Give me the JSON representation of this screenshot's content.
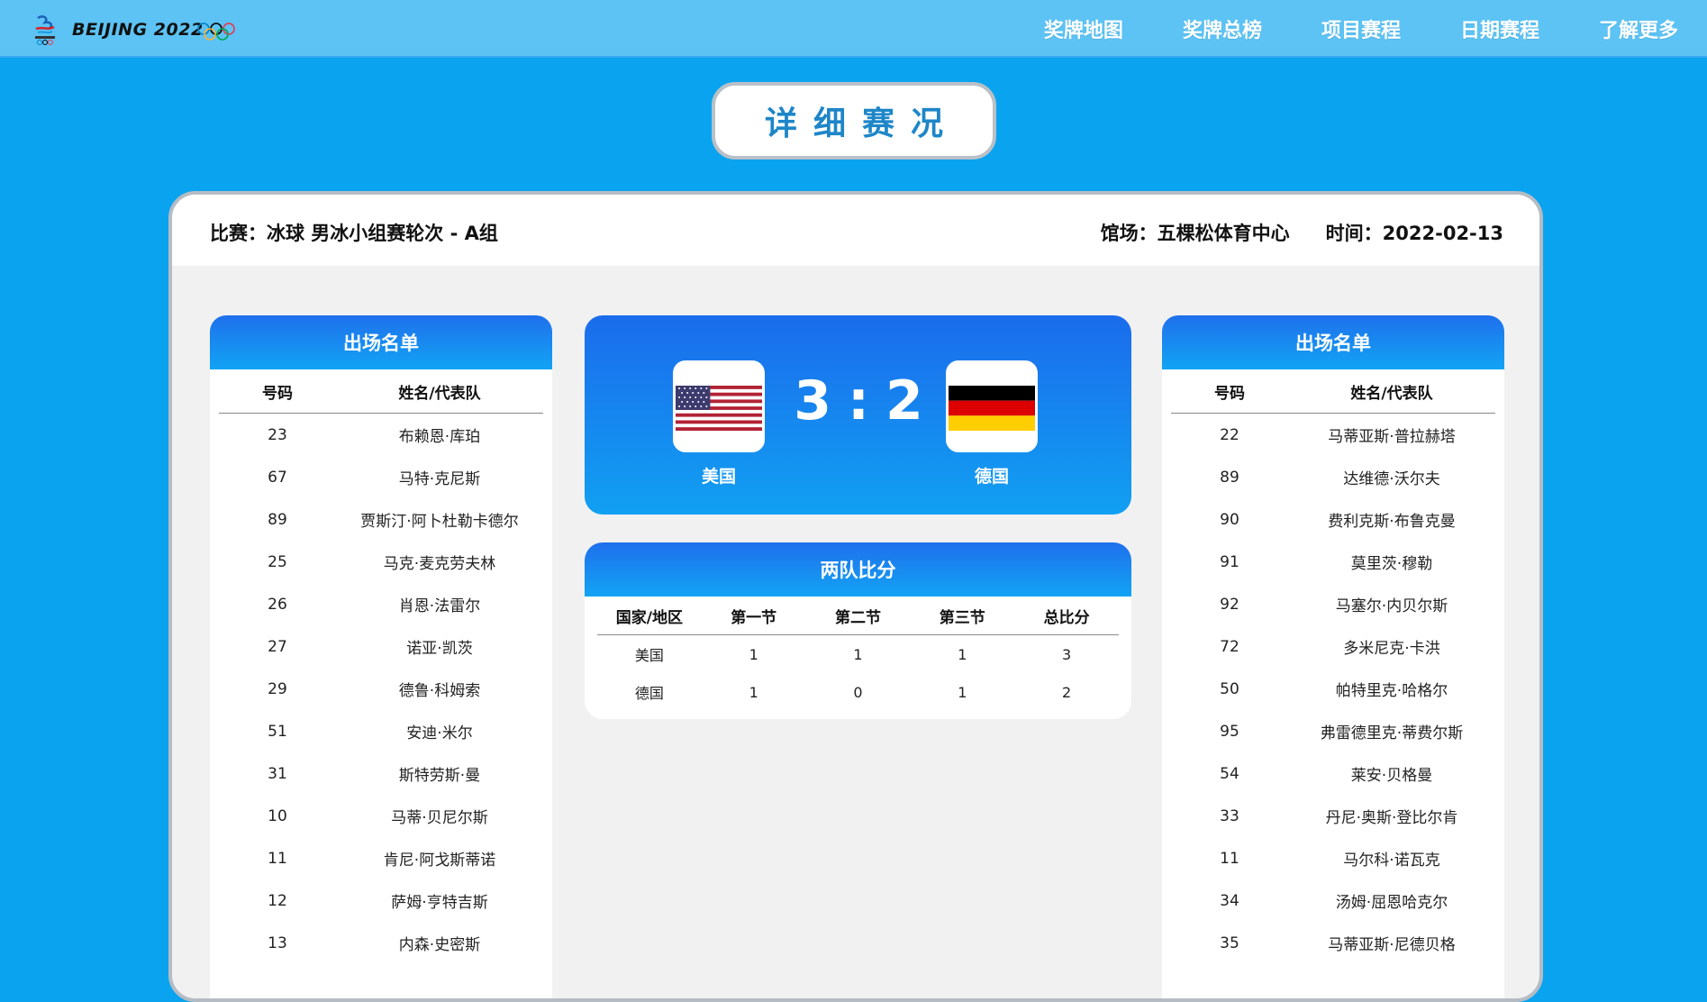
{
  "header": {
    "logo_text": "BEIJING 2022",
    "nav": [
      "奖牌地图",
      "奖牌总榜",
      "项目赛程",
      "日期赛程",
      "了解更多"
    ]
  },
  "page_title": "详细赛况",
  "match": {
    "info": "比赛：冰球 男冰小组赛轮次 - A组",
    "venue": "馆场：五棵松体育中心",
    "time": "时间：2022-02-13"
  },
  "score": {
    "home_team": "美国",
    "away_team": "德国",
    "home_score": "3",
    "away_score": "2",
    "separator": ":"
  },
  "periods": {
    "title": "两队比分",
    "headers": [
      "国家/地区",
      "第一节",
      "第二节",
      "第三节",
      "总比分"
    ],
    "rows": [
      [
        "美国",
        "1",
        "1",
        "1",
        "3"
      ],
      [
        "德国",
        "1",
        "0",
        "1",
        "2"
      ]
    ]
  },
  "left_roster": {
    "title": "出场名单",
    "col_number": "号码",
    "col_name": "姓名/代表队",
    "players": [
      {
        "number": "23",
        "name": "布赖恩·库珀"
      },
      {
        "number": "67",
        "name": "马特·克尼斯"
      },
      {
        "number": "89",
        "name": "贾斯汀·阿卜杜勒卡德尔"
      },
      {
        "number": "25",
        "name": "马克·麦克劳夫林"
      },
      {
        "number": "26",
        "name": "肖恩·法雷尔"
      },
      {
        "number": "27",
        "name": "诺亚·凯茨"
      },
      {
        "number": "29",
        "name": "德鲁·科姆索"
      },
      {
        "number": "51",
        "name": "安迪·米尔"
      },
      {
        "number": "31",
        "name": "斯特劳斯·曼"
      },
      {
        "number": "10",
        "name": "马蒂·贝尼尔斯"
      },
      {
        "number": "11",
        "name": "肯尼·阿戈斯蒂诺"
      },
      {
        "number": "12",
        "name": "萨姆·亨特吉斯"
      },
      {
        "number": "13",
        "name": "内森·史密斯"
      }
    ]
  },
  "right_roster": {
    "title": "出场名单",
    "col_number": "号码",
    "col_name": "姓名/代表队",
    "players": [
      {
        "number": "22",
        "name": "马蒂亚斯·普拉赫塔"
      },
      {
        "number": "89",
        "name": "达维德·沃尔夫"
      },
      {
        "number": "90",
        "name": "费利克斯·布鲁克曼"
      },
      {
        "number": "91",
        "name": "莫里茨·穆勒"
      },
      {
        "number": "92",
        "name": "马塞尔·内贝尔斯"
      },
      {
        "number": "72",
        "name": "多米尼克·卡洪"
      },
      {
        "number": "50",
        "name": "帕特里克·哈格尔"
      },
      {
        "number": "95",
        "name": "弗雷德里克·蒂费尔斯"
      },
      {
        "number": "54",
        "name": "莱安·贝格曼"
      },
      {
        "number": "33",
        "name": "丹尼·奥斯·登比尔肯"
      },
      {
        "number": "11",
        "name": "马尔科·诺瓦克"
      },
      {
        "number": "34",
        "name": "汤姆·屈恩哈克尔"
      },
      {
        "number": "35",
        "name": "马蒂亚斯·尼德贝格"
      }
    ]
  },
  "colors": {
    "background": "#0aa3f0",
    "topbar": "#5cc3f4",
    "card_gradient_top": "#1f70ec",
    "card_gradient_bottom": "#12a4f4",
    "title_text": "#1e86c8"
  },
  "icons": [
    "beijing-2022-emblem-icon",
    "olympic-rings-icon",
    "usa-flag-icon",
    "germany-flag-icon"
  ]
}
